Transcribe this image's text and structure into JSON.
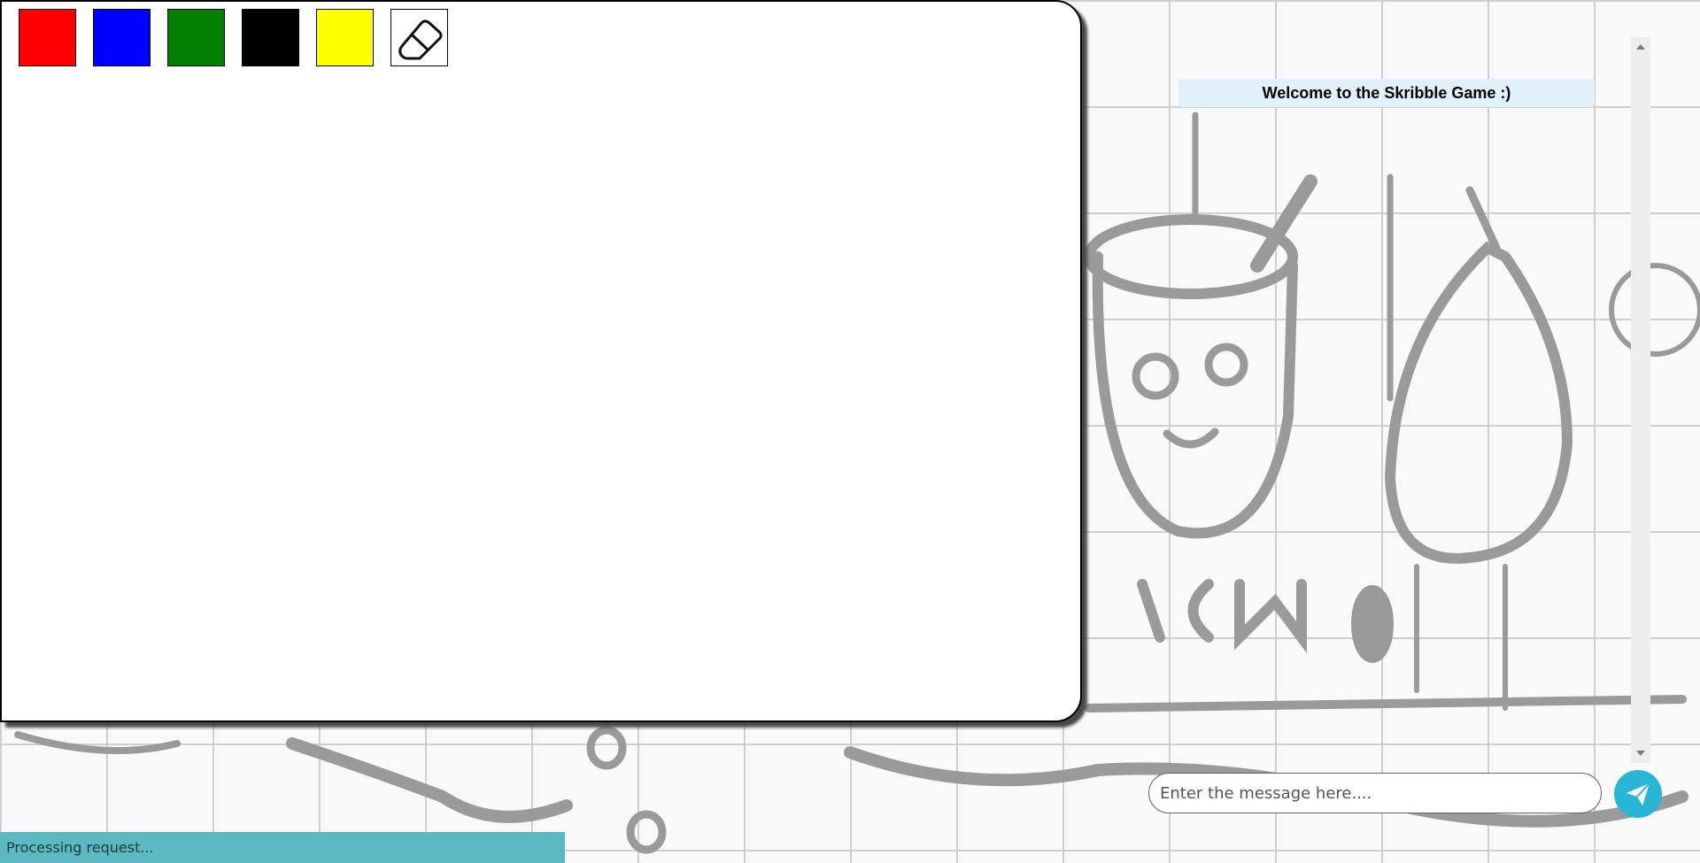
{
  "palette": {
    "colors": [
      {
        "name": "red",
        "hex": "#ff0000"
      },
      {
        "name": "blue",
        "hex": "#0000ff"
      },
      {
        "name": "green",
        "hex": "#007f00"
      },
      {
        "name": "black",
        "hex": "#000000"
      },
      {
        "name": "yellow",
        "hex": "#ffff00"
      }
    ],
    "eraser_icon": "eraser-icon"
  },
  "chat": {
    "welcome_message": "Welcome to the Skribble Game :)",
    "input_placeholder": "Enter the message here....",
    "send_icon": "paper-plane-icon"
  },
  "status": {
    "text": "Processing request..."
  }
}
